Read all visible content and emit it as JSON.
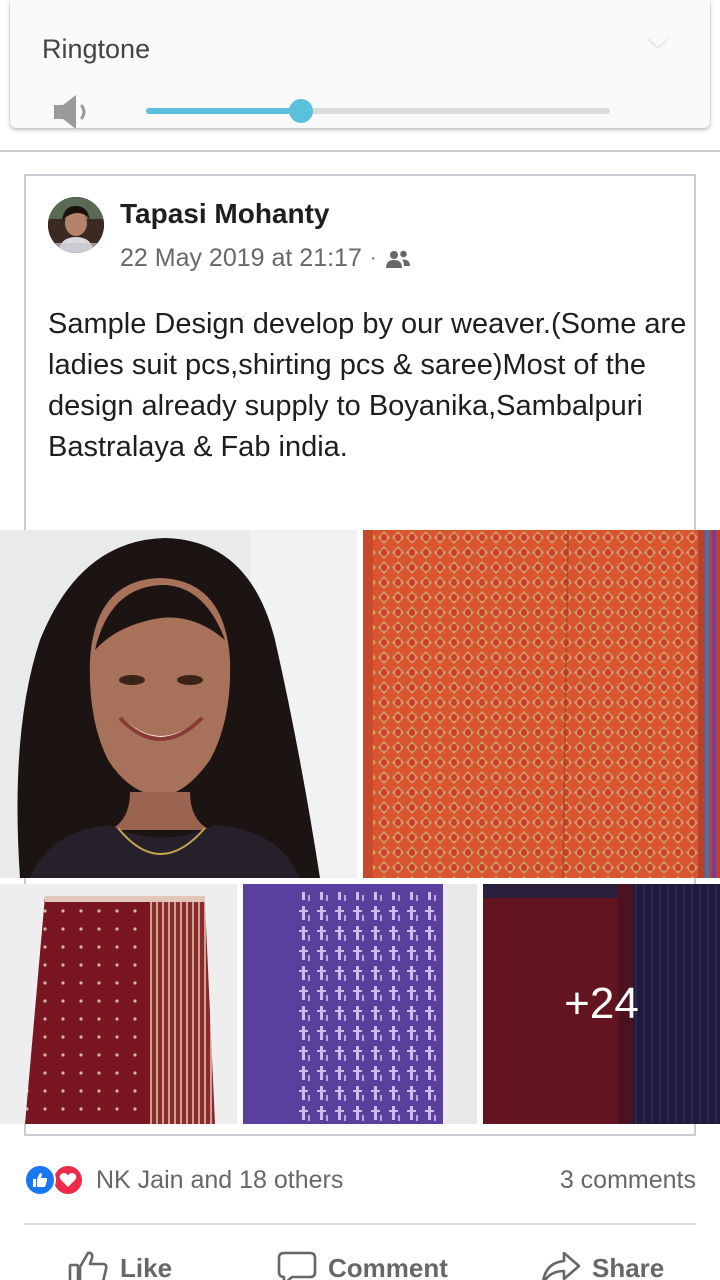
{
  "volume_panel": {
    "title": "Ringtone",
    "level_fraction": 0.333,
    "accent_color": "#5bc0de",
    "icons": [
      "speaker-icon",
      "chevron-down-icon"
    ]
  },
  "post": {
    "author": "Tapasi Mohanty",
    "timestamp": "22 May 2019 at 21:17",
    "separator": "·",
    "audience_icon": "friends-icon",
    "text": "Sample Design develop by our weaver.(Some are ladies suit pcs,shirting pcs & saree)Most of the design already supply to Boyanika,Sambalpuri Bastralaya & Fab india.",
    "more_photos": "+24"
  },
  "reactions": {
    "names": "NK Jain and 18 others",
    "comments": "3 comments",
    "icons": [
      "like-reaction-icon",
      "love-reaction-icon"
    ]
  },
  "actions": {
    "like": "Like",
    "comment": "Comment",
    "share": "Share"
  },
  "colors": {
    "facebook_blue": "#1877f2",
    "love_red": "#f0284a",
    "secondary_text": "#65676b"
  }
}
